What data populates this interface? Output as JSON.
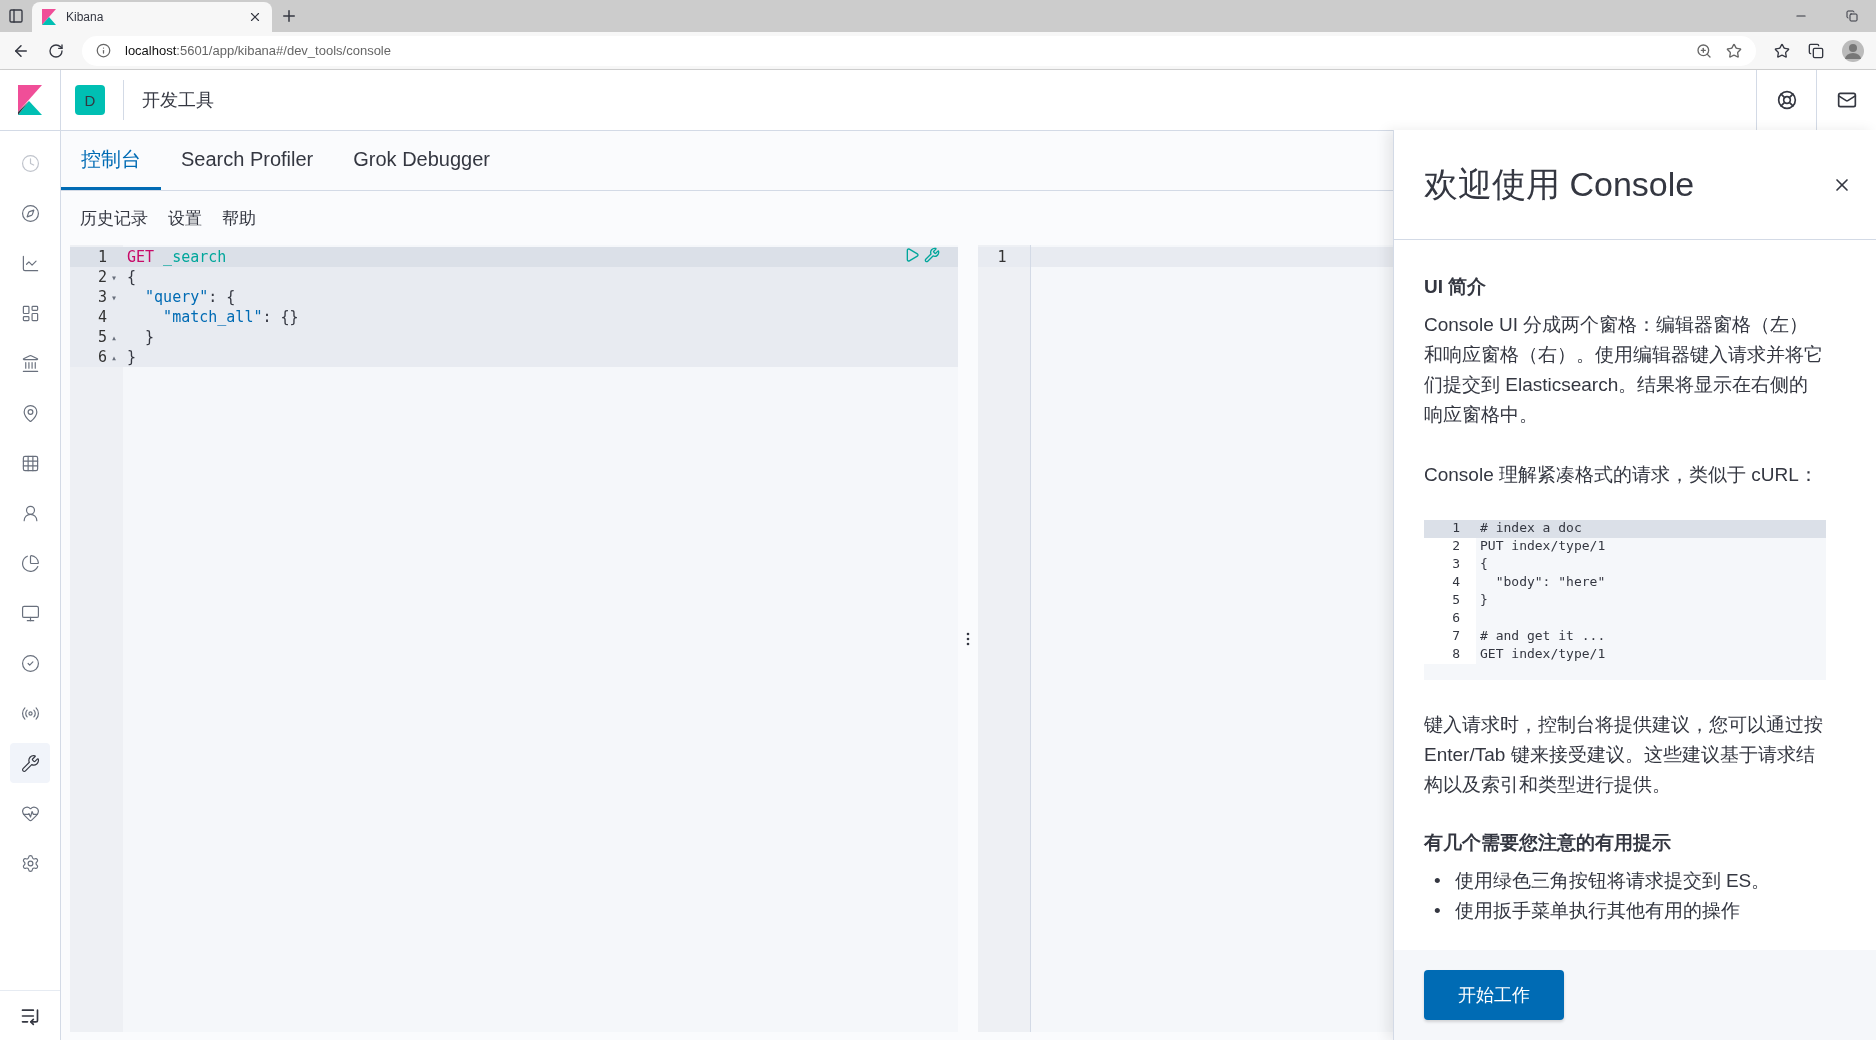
{
  "browser": {
    "tab": {
      "title": "Kibana"
    },
    "url": {
      "host": "localhost",
      "path": ":5601/app/kibana#/dev_tools/console"
    }
  },
  "header": {
    "space": "D",
    "title": "开发工具"
  },
  "nav": [
    {
      "selected": false
    },
    {
      "selected": false
    },
    {
      "selected": false
    },
    {
      "selected": false
    },
    {
      "selected": false
    },
    {
      "selected": false
    },
    {
      "selected": false
    },
    {
      "selected": false
    },
    {
      "selected": false
    },
    {
      "selected": false
    },
    {
      "selected": false
    },
    {
      "selected": false
    },
    {
      "selected": true
    },
    {
      "selected": false
    },
    {
      "selected": false
    }
  ],
  "tabs": [
    {
      "label": "控制台",
      "selected": true
    },
    {
      "label": "Search Profiler",
      "selected": false
    },
    {
      "label": "Grok Debugger",
      "selected": false
    }
  ],
  "menu": [
    "历史记录",
    "设置",
    "帮助"
  ],
  "editor": {
    "lines": [
      {
        "number": "1",
        "selected": true,
        "tokens": [
          {
            "kind": "method",
            "text": "GET"
          },
          {
            "kind": "url",
            "text": " _search"
          }
        ]
      },
      {
        "number": "2",
        "fold_marker": "▾",
        "selected": false,
        "tokens": [
          {
            "kind": "plain",
            "text": "{"
          }
        ]
      },
      {
        "number": "3",
        "fold_marker": "▾",
        "selected": false,
        "tokens": [
          {
            "kind": "key",
            "text": "  \"query\""
          },
          {
            "kind": "plain",
            "text": ": {"
          }
        ]
      },
      {
        "number": "4",
        "selected": false,
        "tokens": [
          {
            "kind": "key",
            "text": "    \"match_all\""
          },
          {
            "kind": "plain",
            "text": ": {}"
          }
        ]
      },
      {
        "number": "5",
        "fold_marker": "▴",
        "selected": false,
        "tokens": [
          {
            "kind": "plain",
            "text": "  }"
          }
        ]
      },
      {
        "number": "6",
        "fold_marker": "▴",
        "selected": false,
        "tokens": [
          {
            "kind": "plain",
            "text": "}"
          }
        ]
      }
    ]
  },
  "output": {
    "lines": [
      "1"
    ]
  },
  "flyout": {
    "title": "欢迎使用 Console",
    "sections": [
      {
        "kind": "heading",
        "text": "UI 简介"
      },
      {
        "kind": "paragraph",
        "text": "Console UI 分成两个窗格：编辑器窗格（左）和响应窗格（右）。使用编辑器键入请求并将它们提交到 Elasticsearch。结果将显示在右侧的响应窗格中。"
      },
      {
        "kind": "paragraph",
        "text": "Console 理解紧凑格式的请求，类似于 cURL："
      },
      {
        "kind": "code",
        "lines": [
          {
            "number": "1",
            "text": "# index a doc",
            "selected": true
          },
          {
            "number": "2",
            "text": "PUT index/type/1",
            "selected": false
          },
          {
            "number": "3",
            "text": "{",
            "selected": false
          },
          {
            "number": "4",
            "text": "  \"body\": \"here\"",
            "selected": false
          },
          {
            "number": "5",
            "text": "}",
            "selected": false
          },
          {
            "number": "6",
            "selected": false
          },
          {
            "number": "7",
            "text": "# and get it ...",
            "selected": false
          },
          {
            "number": "8",
            "text": "GET index/type/1",
            "selected": false
          }
        ]
      },
      {
        "kind": "paragraph",
        "text": "键入请求时，控制台将提供建议，您可以通过按 Enter/Tab 键来接受建议。这些建议基于请求结构以及索引和类型进行提供。"
      },
      {
        "kind": "heading",
        "text": "有几个需要您注意的有用提示"
      },
      {
        "kind": "bullets",
        "items": [
          {
            "marker": "•",
            "text": "使用绿色三角按钮将请求提交到 ES。"
          },
          {
            "marker": "•",
            "text": "使用扳手菜单执行其他有用的操作"
          }
        ]
      }
    ],
    "button": "开始工作"
  }
}
